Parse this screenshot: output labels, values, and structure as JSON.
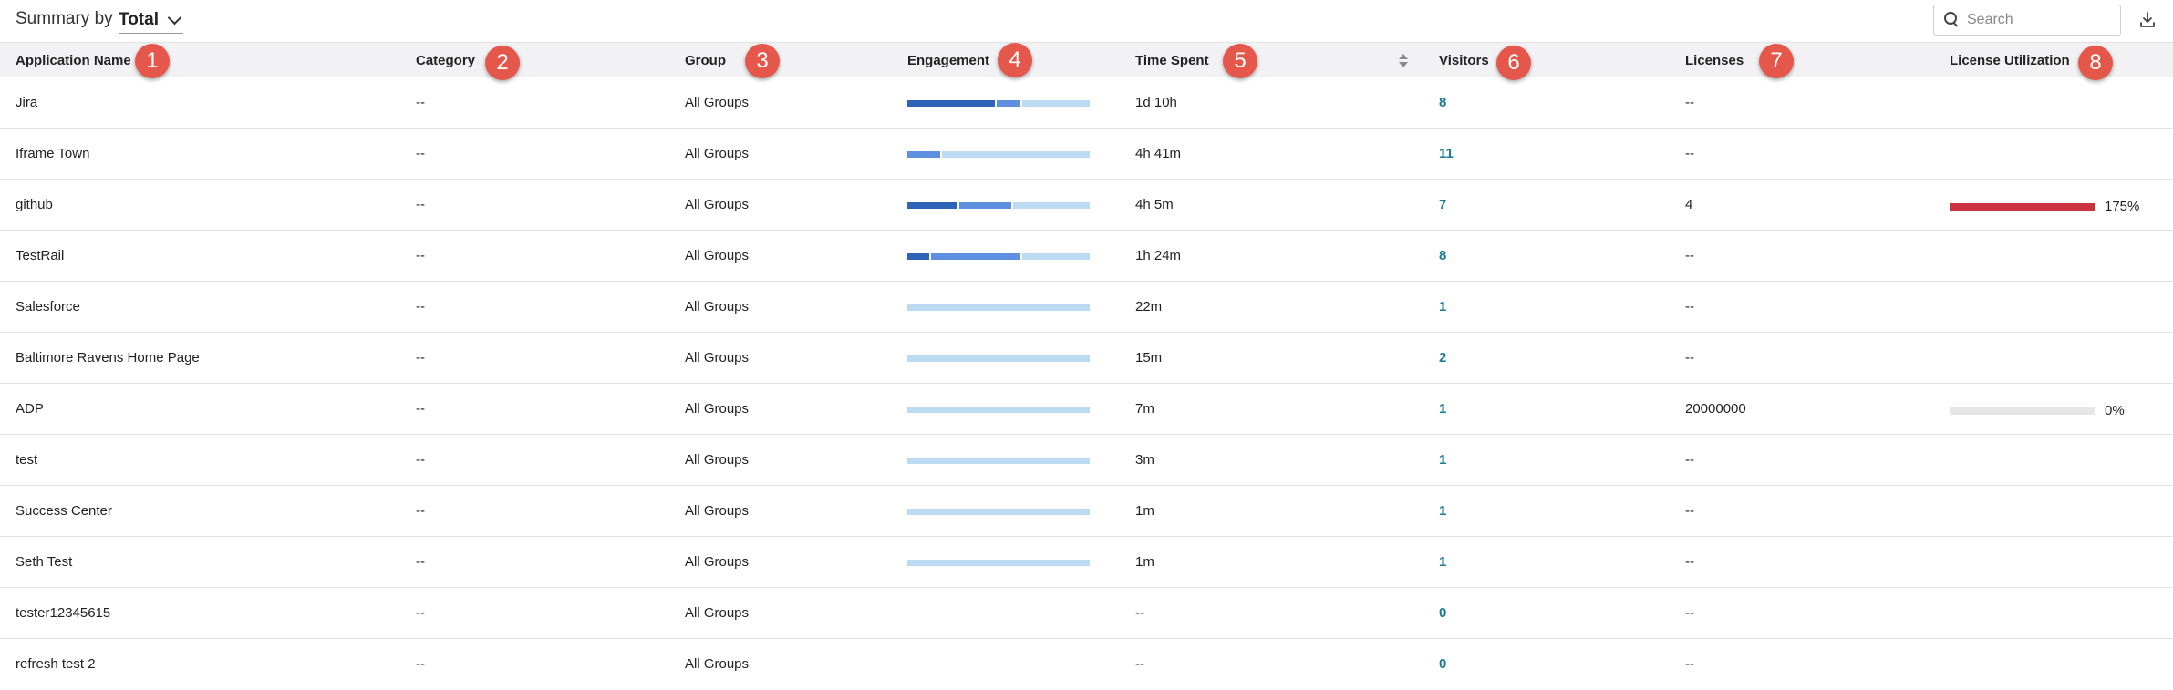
{
  "header": {
    "summary_label": "Summary by",
    "summary_value": "Total"
  },
  "search": {
    "placeholder": "Search"
  },
  "columns": [
    "Application Name",
    "Category",
    "Group",
    "Engagement",
    "Time Spent",
    "Visitors",
    "Licenses",
    "License Utilization"
  ],
  "badges": [
    "1",
    "2",
    "3",
    "4",
    "5",
    "6",
    "7",
    "8"
  ],
  "colors": {
    "eng_high": "#2f63b8",
    "eng_mid": "#5f90e0",
    "eng_low": "#bcdaf2",
    "util_over": "#cc3340",
    "util_track": "#e6e6e6",
    "visitors": "#1a7c96",
    "badge": "#e5574b"
  },
  "rows": [
    {
      "name": "Jira",
      "category": "--",
      "group": "All Groups",
      "engagement": [
        0.49,
        0.13,
        0.38
      ],
      "time_spent": "1d 10h",
      "visitors": "8",
      "licenses": "--",
      "utilization_label": "",
      "utilization": null
    },
    {
      "name": "Iframe Town",
      "category": "--",
      "group": "All Groups",
      "engagement": [
        0,
        0.18,
        0.82
      ],
      "time_spent": "4h 41m",
      "visitors": "11",
      "licenses": "--",
      "utilization_label": "",
      "utilization": null
    },
    {
      "name": "github",
      "category": "--",
      "group": "All Groups",
      "engagement": [
        0.28,
        0.29,
        0.43
      ],
      "time_spent": "4h 5m",
      "visitors": "7",
      "licenses": "4",
      "utilization_label": "175%",
      "utilization": 1.75
    },
    {
      "name": "TestRail",
      "category": "--",
      "group": "All Groups",
      "engagement": [
        0.12,
        0.5,
        0.38
      ],
      "time_spent": "1h 24m",
      "visitors": "8",
      "licenses": "--",
      "utilization_label": "",
      "utilization": null
    },
    {
      "name": "Salesforce",
      "category": "--",
      "group": "All Groups",
      "engagement": [
        0,
        0,
        1
      ],
      "time_spent": "22m",
      "visitors": "1",
      "licenses": "--",
      "utilization_label": "",
      "utilization": null
    },
    {
      "name": "Baltimore Ravens Home Page",
      "category": "--",
      "group": "All Groups",
      "engagement": [
        0,
        0,
        1
      ],
      "time_spent": "15m",
      "visitors": "2",
      "licenses": "--",
      "utilization_label": "",
      "utilization": null
    },
    {
      "name": "ADP",
      "category": "--",
      "group": "All Groups",
      "engagement": [
        0,
        0,
        1
      ],
      "time_spent": "7m",
      "visitors": "1",
      "licenses": "20000000",
      "utilization_label": "0%",
      "utilization": 0
    },
    {
      "name": "test",
      "category": "--",
      "group": "All Groups",
      "engagement": [
        0,
        0,
        1
      ],
      "time_spent": "3m",
      "visitors": "1",
      "licenses": "--",
      "utilization_label": "",
      "utilization": null
    },
    {
      "name": "Success Center",
      "category": "--",
      "group": "All Groups",
      "engagement": [
        0,
        0,
        1
      ],
      "time_spent": "1m",
      "visitors": "1",
      "licenses": "--",
      "utilization_label": "",
      "utilization": null
    },
    {
      "name": "Seth Test",
      "category": "--",
      "group": "All Groups",
      "engagement": [
        0,
        0,
        1
      ],
      "time_spent": "1m",
      "visitors": "1",
      "licenses": "--",
      "utilization_label": "",
      "utilization": null
    },
    {
      "name": "tester12345615",
      "category": "--",
      "group": "All Groups",
      "engagement": null,
      "time_spent": "--",
      "visitors": "0",
      "licenses": "--",
      "utilization_label": "",
      "utilization": null
    },
    {
      "name": "refresh test 2",
      "category": "--",
      "group": "All Groups",
      "engagement": null,
      "time_spent": "--",
      "visitors": "0",
      "licenses": "--",
      "utilization_label": "",
      "utilization": null
    }
  ]
}
